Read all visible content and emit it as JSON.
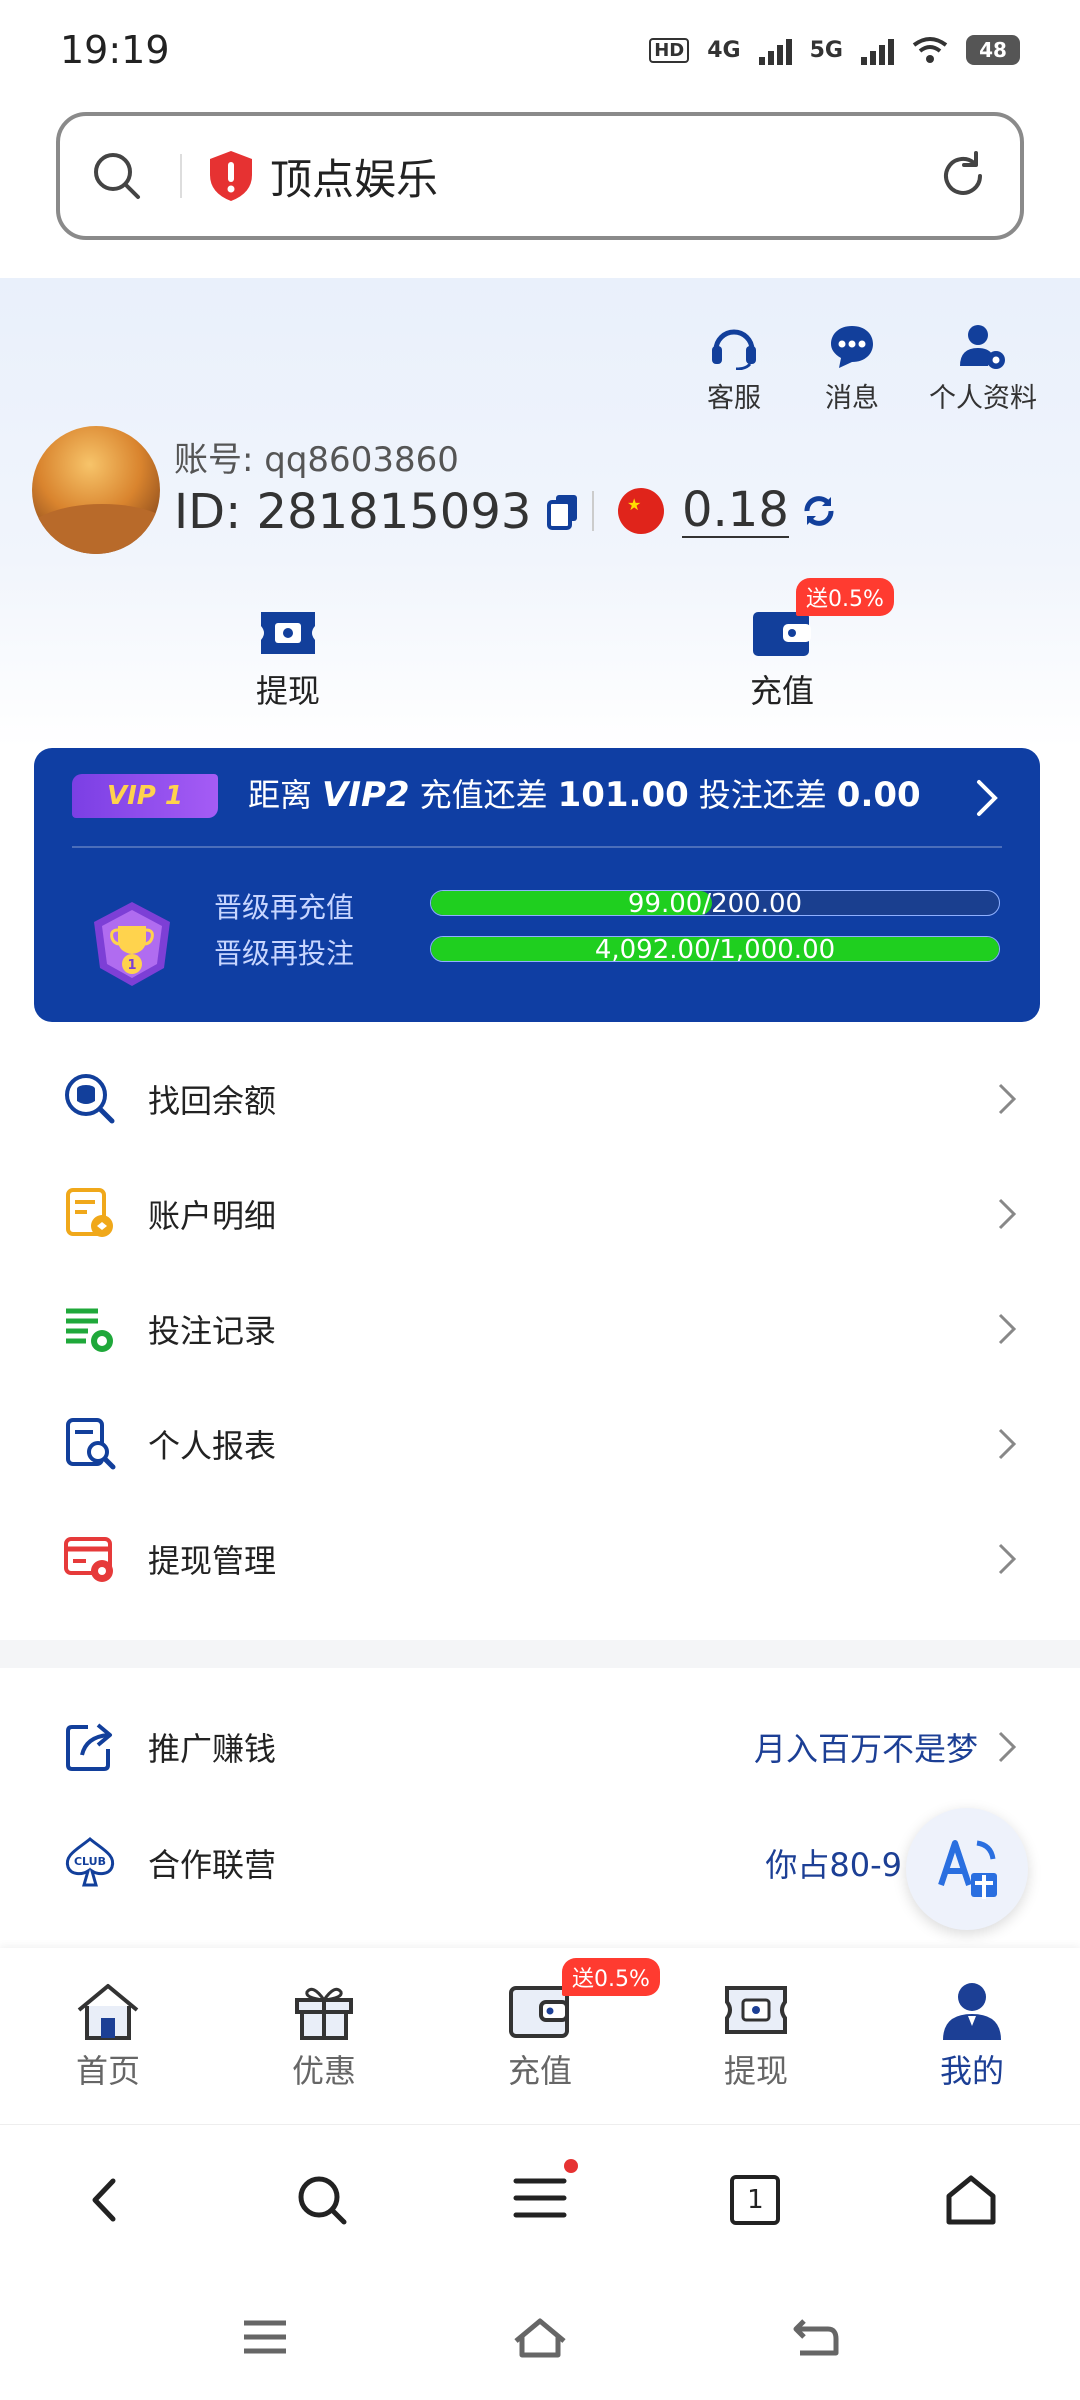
{
  "status": {
    "time": "19:19",
    "battery": "48",
    "network1": "4G",
    "network2": "5G"
  },
  "url_bar": {
    "site_name": "顶点娱乐"
  },
  "top_actions": [
    {
      "label": "客服",
      "icon": "headset-icon"
    },
    {
      "label": "消息",
      "icon": "chat-bubble-icon"
    },
    {
      "label": "个人资料",
      "icon": "profile-settings-icon"
    }
  ],
  "account": {
    "username_label": "账号: qq8603860",
    "id_label": "ID: 281815093",
    "balance": "0.18"
  },
  "quick_actions": {
    "withdraw": "提现",
    "deposit": "充值",
    "deposit_promo": "送0.5%"
  },
  "vip": {
    "current_level": "VIP 1",
    "prefix": "距离",
    "next_level": "VIP2",
    "deposit_text": "充值还差",
    "deposit_remaining": "101.00",
    "bet_text": "投注还差",
    "bet_remaining": "0.00",
    "progress": [
      {
        "label": "晋级再充值",
        "text": "99.00/200.00",
        "fraction": 0.495
      },
      {
        "label": "晋级再投注",
        "text": "4,092.00/1,000.00",
        "fraction": 1.0
      }
    ]
  },
  "menu": [
    {
      "label": "找回余额",
      "icon": "balance-search-icon"
    },
    {
      "label": "账户明细",
      "icon": "account-details-icon"
    },
    {
      "label": "投注记录",
      "icon": "bet-records-icon"
    },
    {
      "label": "个人报表",
      "icon": "report-icon"
    },
    {
      "label": "提现管理",
      "icon": "withdraw-management-icon"
    }
  ],
  "menu2": [
    {
      "label": "推广赚钱",
      "extra": "月入百万不是梦",
      "icon": "share-icon"
    },
    {
      "label": "合作联营",
      "extra": "你占80-9",
      "icon": "club-icon"
    }
  ],
  "tabs": [
    {
      "label": "首页",
      "icon": "home-icon"
    },
    {
      "label": "优惠",
      "icon": "gift-icon"
    },
    {
      "label": "充值",
      "icon": "wallet-icon",
      "promo": "送0.5%"
    },
    {
      "label": "提现",
      "icon": "cash-icon"
    },
    {
      "label": "我的",
      "icon": "user-icon",
      "active": true
    }
  ],
  "browser_nav": {
    "tab_count": "1"
  },
  "colors": {
    "primary": "#0f3ea3",
    "accent_text": "#1c3f95",
    "promo": "#ff3b30",
    "progress": "#1fcf1f"
  }
}
